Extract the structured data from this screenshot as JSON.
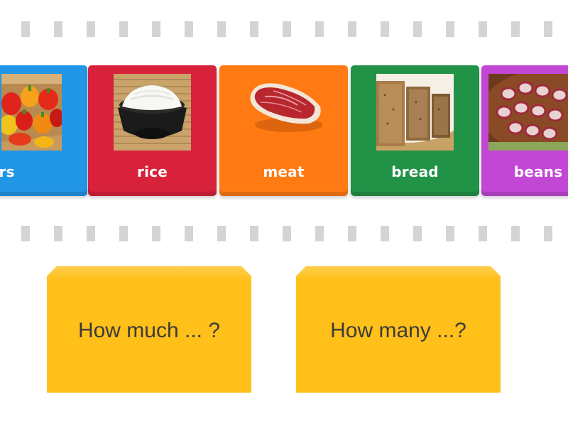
{
  "cards": [
    {
      "id": "peppers",
      "label": "eppers",
      "image": "peppers-photo",
      "color": "#2196e6"
    },
    {
      "id": "rice",
      "label": "rice",
      "image": "rice-bowl-photo",
      "color": "#d8213b"
    },
    {
      "id": "meat",
      "label": "meat",
      "image": "steak-photo",
      "color": "#ff7a12"
    },
    {
      "id": "bread",
      "label": "bread",
      "image": "bread-basket-photo",
      "color": "#229246"
    },
    {
      "id": "beans",
      "label": "beans",
      "image": "beans-photo",
      "color": "#c247d5"
    }
  ],
  "targets": [
    {
      "id": "much",
      "label": "How much ... ?",
      "color": "#ffc01a"
    },
    {
      "id": "many",
      "label": "How many ...?",
      "color": "#ffc01a"
    }
  ],
  "colors": {
    "strip_dash": "#d4d4d4",
    "target_text": "#3b3b3b"
  }
}
